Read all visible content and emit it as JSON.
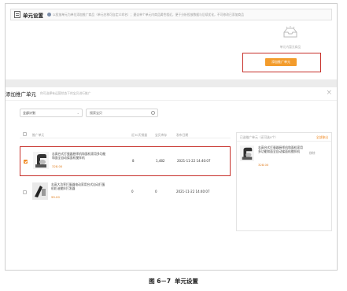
{
  "unit_settings": {
    "title": "单元设置",
    "tip": "以投放单元为单位添加推广商品（单元名称可自定义命名）；建议单个单元内商品属性相近，便于分析投放数据与后续优化，不可修改已添加商品",
    "empty_text": "单元内暂无商品",
    "add_button": "添加推广单元"
  },
  "modal": {
    "title": "添加推广单元",
    "tip": "你可选择有运营状态下的宝贝进行推广",
    "close": "×",
    "plan_select": "全部计划",
    "search_placeholder": "搜索宝贝",
    "columns": {
      "product": "推广单元",
      "sales": "近30天销量",
      "stock": "宝贝库存",
      "date": "发布日期"
    },
    "rows": [
      {
        "name": "志高台式打蛋器厨师机和面机家用多功能和面全自动揉面机搅拌机",
        "price": "328.00",
        "sales": "8",
        "stock": "1,482",
        "date": "2021-11-22 14:40:07",
        "checked": true
      },
      {
        "name": "志高大功率打蛋器电动家用台式自动打蛋机奶油搅拌打发器",
        "price": "99.00",
        "sales": "0",
        "stock": "0",
        "date": "2021-11-22 14:40:07",
        "checked": false
      }
    ],
    "selected_panel": {
      "title": "已选推广单元（还可选0个）",
      "clear": "全部移出",
      "item_name": "志高台式打蛋器厨师机和面机家用多功能和面全自动揉面机搅拌机",
      "item_price": "328.00",
      "remove": "移除"
    }
  },
  "caption": {
    "figure": "图 6－7",
    "text": "单元设置"
  },
  "colors": {
    "accent_orange": "#f39c2c",
    "highlight_red": "#c7302a"
  }
}
